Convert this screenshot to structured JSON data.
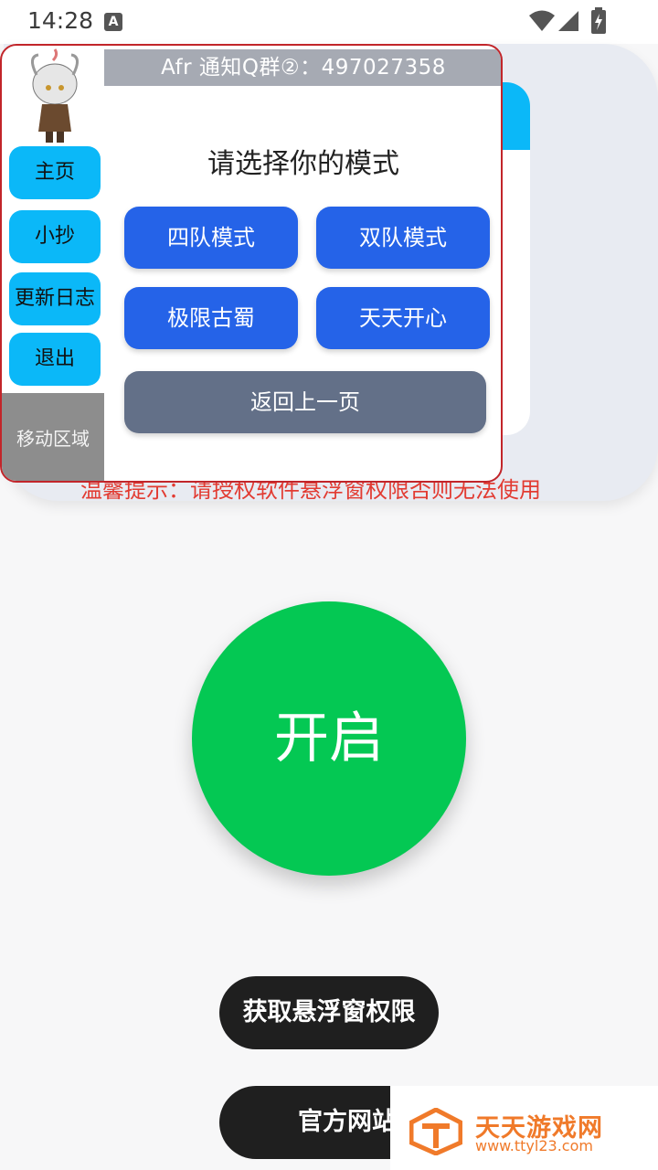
{
  "status_bar": {
    "time": "14:28",
    "a_badge": "A"
  },
  "background": {
    "warning": "温馨提示：请授权软件悬浮窗权限否则无法使用"
  },
  "panel": {
    "notice": "Afr 通知Q群②：497027358",
    "title": "请选择你的模式",
    "side_menu": [
      "主页",
      "小抄",
      "更新日志",
      "退出"
    ],
    "move_area": "移动区域",
    "modes": [
      "四队模式",
      "双队模式",
      "极限古蜀",
      "天天开心"
    ],
    "back": "返回上一页"
  },
  "main": {
    "start": "开启",
    "permission": "获取悬浮窗权限",
    "website": "官方网站"
  },
  "watermark": {
    "name": "天天游戏网",
    "url": "www.ttyl23.com"
  },
  "colors": {
    "accent_blue": "#2563e8",
    "side_blue": "#0bb8f8",
    "start_green": "#04c853",
    "warning_red": "#e23b32",
    "panel_border": "#c2252a"
  },
  "icons": [
    "wifi-icon",
    "signal-icon",
    "battery-charging-icon",
    "accessibility-a-icon",
    "avatar-image",
    "watermark-logo-icon"
  ]
}
